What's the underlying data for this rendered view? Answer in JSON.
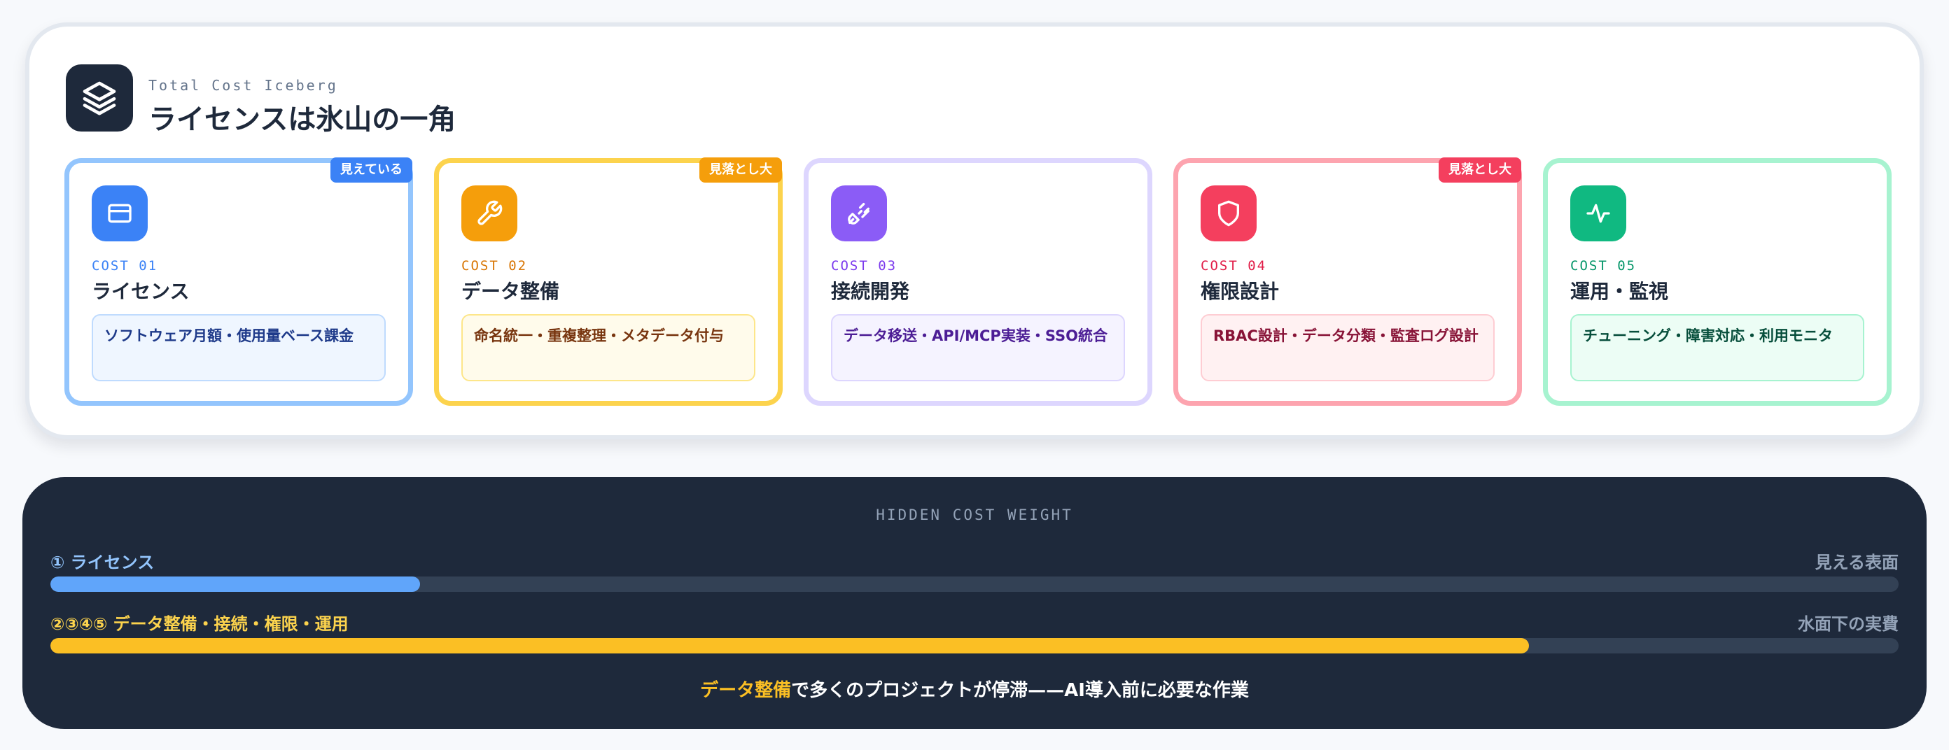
{
  "header": {
    "eyebrow": "Total Cost Iceberg",
    "title": "ライセンスは氷山の一角",
    "icon": "layers-icon"
  },
  "cards": [
    {
      "code": "COST 01",
      "title": "ライセンス",
      "desc": "ソフトウェア月額・使用量ベース課金",
      "badge": "見えている",
      "icon": "credit-card-icon",
      "accent": "#3b82f6",
      "border": "#93c5fd",
      "desc_bg": "#eff6ff",
      "desc_border": "#bfdbfe",
      "desc_color": "#1e3a8a"
    },
    {
      "code": "COST 02",
      "title": "データ整備",
      "desc": "命名統一・重複整理・メタデータ付与",
      "badge": "見落とし大",
      "icon": "wrench-icon",
      "accent": "#f59e0b",
      "border": "#fcd34d",
      "desc_bg": "#fffbeb",
      "desc_border": "#fde68a",
      "desc_color": "#78350f"
    },
    {
      "code": "COST 03",
      "title": "接続開発",
      "desc": "データ移送・API/MCP実装・SSO統合",
      "badge": "",
      "icon": "plug-icon",
      "accent": "#8b5cf6",
      "border": "#ddd6fe",
      "desc_bg": "#f5f3ff",
      "desc_border": "#ddd6fe",
      "desc_color": "#4c1d95"
    },
    {
      "code": "COST 04",
      "title": "権限設計",
      "desc": "RBAC設計・データ分類・監査ログ設計",
      "badge": "見落とし大",
      "icon": "shield-icon",
      "accent": "#f43f5e",
      "border": "#fda4af",
      "desc_bg": "#fff1f2",
      "desc_border": "#fecdd3",
      "desc_color": "#881337"
    },
    {
      "code": "COST 05",
      "title": "運用・監視",
      "desc": "チューニング・障害対応・利用モニタ",
      "badge": "",
      "icon": "activity-icon",
      "accent": "#10b981",
      "border": "#a7f3d0",
      "desc_bg": "#ecfdf5",
      "desc_border": "#a7f3d0",
      "desc_color": "#064e3b"
    }
  ],
  "weight": {
    "label": "HIDDEN COST WEIGHT",
    "bars": [
      {
        "label": "① ライセンス",
        "tag": "見える表面",
        "fill": 0.2,
        "color": "#60a5fa",
        "label_color": "#93c5fd"
      },
      {
        "label": "②③④⑤ データ整備・接続・権限・運用",
        "tag": "水面下の実費",
        "fill": 0.8,
        "color": "#fbbf24",
        "label_color": "#fcd34d"
      }
    ],
    "footnote_highlight": "データ整備",
    "footnote_rest": "で多くのプロジェクトが停滞——AI導入前に必要な作業"
  }
}
